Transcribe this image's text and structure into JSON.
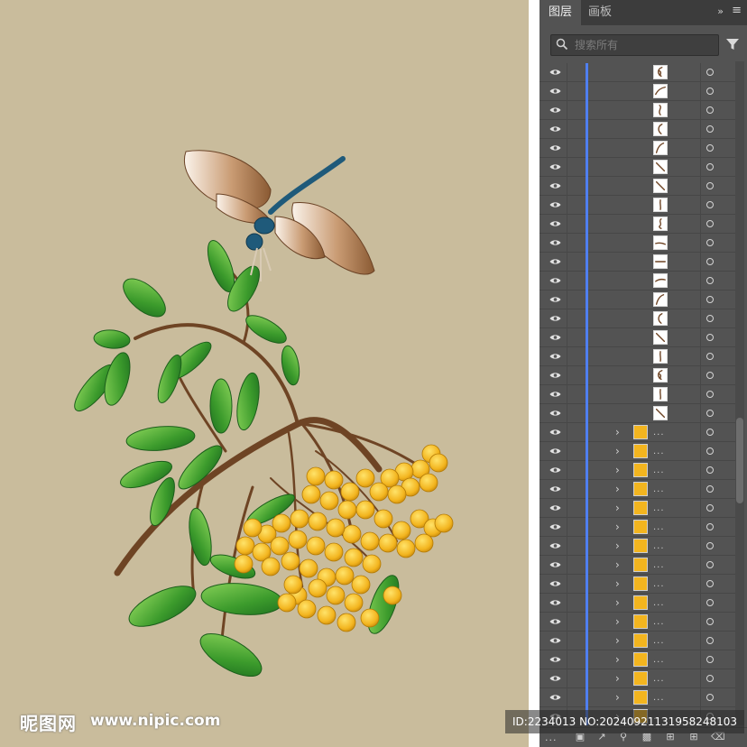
{
  "panel": {
    "tabs": [
      {
        "label": "图层",
        "active": true
      },
      {
        "label": "画板",
        "active": false
      }
    ],
    "expand_icon": "double-chevron-icon",
    "menu_icon": "hamburger-icon",
    "search": {
      "placeholder": "搜索所有",
      "value": ""
    },
    "filter_icon": "funnel-icon",
    "row_name_truncated": "...",
    "layer_count": "...",
    "footer_icons": [
      "collect-for-export-icon",
      "export-icon",
      "locate-object-icon",
      "clipping-mask-icon",
      "new-sublayer-icon",
      "new-layer-icon",
      "trash-icon"
    ],
    "rows": [
      {
        "kind": "path",
        "thumb": "curl"
      },
      {
        "kind": "path",
        "thumb": "swoosh"
      },
      {
        "kind": "path",
        "thumb": "s-curve"
      },
      {
        "kind": "path",
        "thumb": "hook"
      },
      {
        "kind": "path",
        "thumb": "arc"
      },
      {
        "kind": "path",
        "thumb": "diag"
      },
      {
        "kind": "path",
        "thumb": "diag"
      },
      {
        "kind": "path",
        "thumb": "vline"
      },
      {
        "kind": "path",
        "thumb": "swirl"
      },
      {
        "kind": "path",
        "thumb": "flat"
      },
      {
        "kind": "path",
        "thumb": "hline"
      },
      {
        "kind": "path",
        "thumb": "stroke"
      },
      {
        "kind": "path",
        "thumb": "arc"
      },
      {
        "kind": "path",
        "thumb": "hook"
      },
      {
        "kind": "path",
        "thumb": "diag"
      },
      {
        "kind": "path",
        "thumb": "vline"
      },
      {
        "kind": "path",
        "thumb": "curl"
      },
      {
        "kind": "path",
        "thumb": "vline"
      },
      {
        "kind": "path",
        "thumb": "diag"
      },
      {
        "kind": "berry"
      },
      {
        "kind": "berry"
      },
      {
        "kind": "berry"
      },
      {
        "kind": "berry"
      },
      {
        "kind": "berry"
      },
      {
        "kind": "berry"
      },
      {
        "kind": "berry"
      },
      {
        "kind": "berry"
      },
      {
        "kind": "berry"
      },
      {
        "kind": "berry"
      },
      {
        "kind": "berry"
      },
      {
        "kind": "berry"
      },
      {
        "kind": "berry"
      },
      {
        "kind": "berry"
      },
      {
        "kind": "berry"
      },
      {
        "kind": "berry"
      }
    ]
  },
  "watermark": {
    "logo": "昵图网",
    "site": "www.nipic.com",
    "id": "ID:2234013 NO:20240921131958248103"
  },
  "colors": {
    "canvas": "#c9bc9c",
    "panel": "#535353",
    "layer_bar": "#4f7ff0",
    "berry": "#f3b51f",
    "leaf": "#3f9d2c",
    "branch": "#6e4424",
    "dragonfly_body": "#1f5a7a",
    "wing": "#a8734c"
  }
}
